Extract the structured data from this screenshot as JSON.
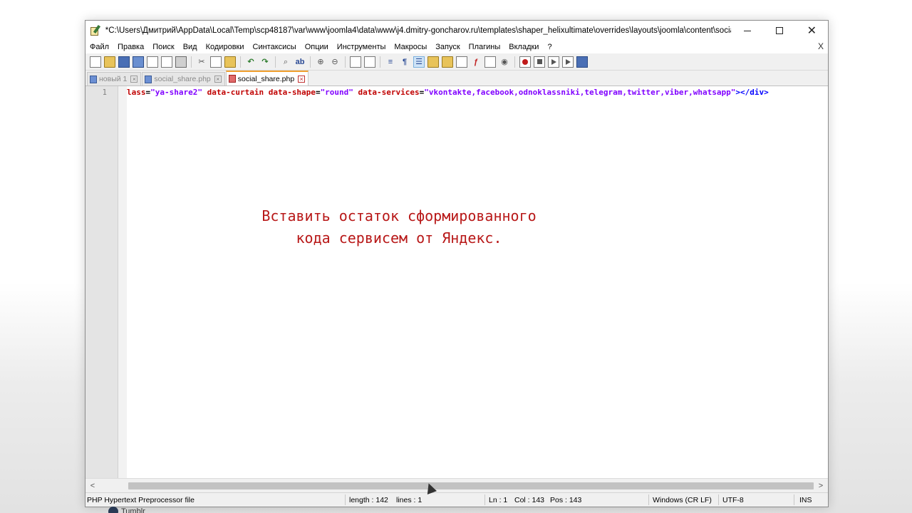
{
  "window": {
    "title": "*C:\\Users\\Дмитрий\\AppData\\Local\\Temp\\scp48187\\var\\www\\joomla4\\data\\www\\j4.dmitry-goncharov.ru\\templates\\shaper_helixultimate\\overrides\\layouts\\joomla\\content\\social_share....",
    "controls": {
      "minimize": "",
      "maximize": "",
      "close": "✕"
    }
  },
  "menu": {
    "items": [
      "Файл",
      "Правка",
      "Поиск",
      "Вид",
      "Кодировки",
      "Синтаксисы",
      "Опции",
      "Инструменты",
      "Макросы",
      "Запуск",
      "Плагины",
      "Вкладки",
      "?"
    ],
    "close": "X"
  },
  "toolbar": {
    "icons": [
      "new-icon",
      "open-icon",
      "save-icon",
      "save-all-icon",
      "close-icon",
      "close-all-icon",
      "print-icon",
      "cut-icon",
      "copy-icon",
      "paste-icon",
      "undo-icon",
      "redo-icon",
      "find-icon",
      "replace-icon",
      "zoom-in-icon",
      "zoom-out-icon",
      "sync-v-icon",
      "sync-h-icon",
      "wrap-icon",
      "all-chars-icon",
      "indent-guide-icon",
      "lang-icon",
      "doc-map-icon",
      "function-list-icon",
      "folder-workspace-icon",
      "monitor-icon",
      "record-icon",
      "stop-icon",
      "play-icon",
      "play-multi-icon",
      "save-macro-icon"
    ]
  },
  "tabs": [
    {
      "label": "новый 1",
      "active": false,
      "icon": "blue"
    },
    {
      "label": "social_share.php",
      "active": false,
      "icon": "blue"
    },
    {
      "label": "social_share.php",
      "active": true,
      "icon": "red"
    }
  ],
  "editor": {
    "line_number": "1",
    "code": {
      "p1": "lass",
      "p2": "=",
      "p3": "\"ya-share2\"",
      "p4": " data-curtain data-shape",
      "p5": "=",
      "p6": "\"round\"",
      "p7": " data-services",
      "p8": "=",
      "p9": "\"vkontakte,facebook,odnoklassniki,telegram,twitter,viber,whatsapp\"",
      "p10": "></div>"
    }
  },
  "overlay": {
    "line1": "Вставить остаток сформированного",
    "line2": "кода сервисем от Яндекс."
  },
  "scrollbar": {
    "left": "<",
    "right": ">"
  },
  "status": {
    "file_type": "PHP Hypertext Preprocessor file",
    "length": "length : 142",
    "lines": "lines : 1",
    "ln": "Ln : 1",
    "col": "Col : 143",
    "pos": "Pos : 143",
    "eol": "Windows (CR LF)",
    "encoding": "UTF-8",
    "mode": "INS"
  },
  "below": {
    "text": "Tumblr"
  }
}
